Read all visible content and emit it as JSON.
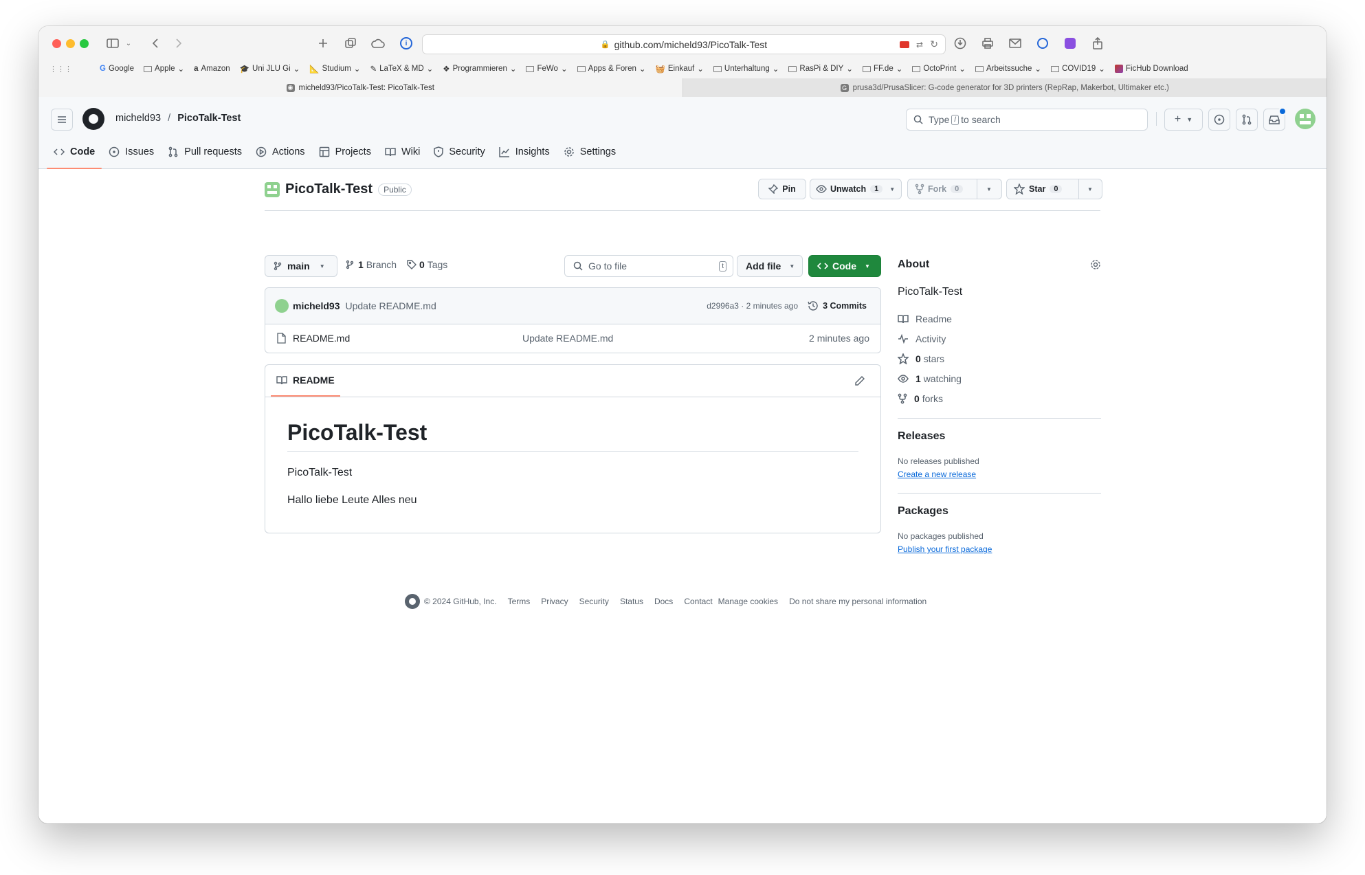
{
  "browser": {
    "url": "github.com/micheld93/PicoTalk-Test",
    "bookmarks": [
      "Google",
      "Apple",
      "Amazon",
      "Uni JLU Gi",
      "Studium",
      "LaTeX & MD",
      "Programmieren",
      "FeWo",
      "Apps & Foren",
      "Einkauf",
      "Unterhaltung",
      "RasPi & DIY",
      "FF.de",
      "OctoPrint",
      "Arbeitssuche",
      "COVID19",
      "FicHub Download"
    ],
    "tabs": [
      {
        "title": "micheld93/PicoTalk-Test: PicoTalk-Test"
      },
      {
        "title": "prusa3d/PrusaSlicer: G-code generator for 3D printers (RepRap, Makerbot, Ultimaker etc.)"
      }
    ]
  },
  "header": {
    "owner": "micheld93",
    "separator": "/",
    "repo": "PicoTalk-Test",
    "search_pre": "Type",
    "search_key": "/",
    "search_post": "to search"
  },
  "repo_nav": [
    "Code",
    "Issues",
    "Pull requests",
    "Actions",
    "Projects",
    "Wiki",
    "Security",
    "Insights",
    "Settings"
  ],
  "repo": {
    "name": "PicoTalk-Test",
    "visibility": "Public",
    "pin": "Pin",
    "unwatch": "Unwatch",
    "unwatch_count": "1",
    "fork": "Fork",
    "fork_count": "0",
    "star": "Star",
    "star_count": "0"
  },
  "code_bar": {
    "branch": "main",
    "branches_n": "1",
    "branches": "Branch",
    "tags_n": "0",
    "tags": "Tags",
    "goto_placeholder": "Go to file",
    "goto_key": "t",
    "add_file": "Add file",
    "code": "Code"
  },
  "commit": {
    "author": "micheld93",
    "message": "Update README.md",
    "meta": "d2996a3 · 2 minutes ago",
    "commits": "3 Commits"
  },
  "files": [
    {
      "name": "README.md",
      "message": "Update README.md",
      "time": "2 minutes ago"
    }
  ],
  "readme": {
    "tab": "README",
    "heading": "PicoTalk-Test",
    "p1": "PicoTalk-Test",
    "p2": "Hallo liebe Leute Alles neu"
  },
  "about": {
    "title": "About",
    "description": "PicoTalk-Test",
    "readme": "Readme",
    "activity": "Activity",
    "stars_n": "0",
    "stars": "stars",
    "watching_n": "1",
    "watching": "watching",
    "forks_n": "0",
    "forks": "forks",
    "releases_title": "Releases",
    "releases_none": "No releases published",
    "releases_link": "Create a new release",
    "packages_title": "Packages",
    "packages_none": "No packages published",
    "packages_link": "Publish your first package"
  },
  "footer": {
    "copyright": "© 2024 GitHub, Inc.",
    "links": [
      "Terms",
      "Privacy",
      "Security",
      "Status",
      "Docs",
      "Contact",
      "Manage cookies",
      "Do not share my personal information"
    ]
  },
  "colors": {
    "accent_green": "#1f883d",
    "nav_underline": "#fd8c73",
    "link": "#0969da"
  }
}
